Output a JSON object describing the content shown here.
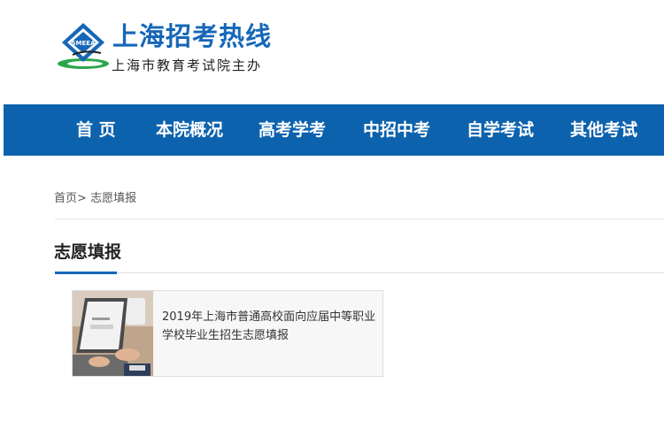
{
  "header": {
    "site_title": "上海招考热线",
    "site_subtitle": "上海市教育考试院主办",
    "logo_text": "SMEEA"
  },
  "nav": {
    "items": [
      {
        "label": "首 页"
      },
      {
        "label": "本院概况"
      },
      {
        "label": "高考学考"
      },
      {
        "label": "中招中考"
      },
      {
        "label": "自学考试"
      },
      {
        "label": "其他考试"
      }
    ]
  },
  "breadcrumb": {
    "home": "首页",
    "separator": ">",
    "current": "志愿填报"
  },
  "section": {
    "title": "志愿填报"
  },
  "articles": [
    {
      "title": "2019年上海市普通高校面向应届中等职业学校毕业生招生志愿填报",
      "thumbnail": "laptop-photo"
    }
  ],
  "colors": {
    "brand_blue": "#0d62ad",
    "title_blue": "#1667b8",
    "logo_green": "#2aa64a"
  }
}
